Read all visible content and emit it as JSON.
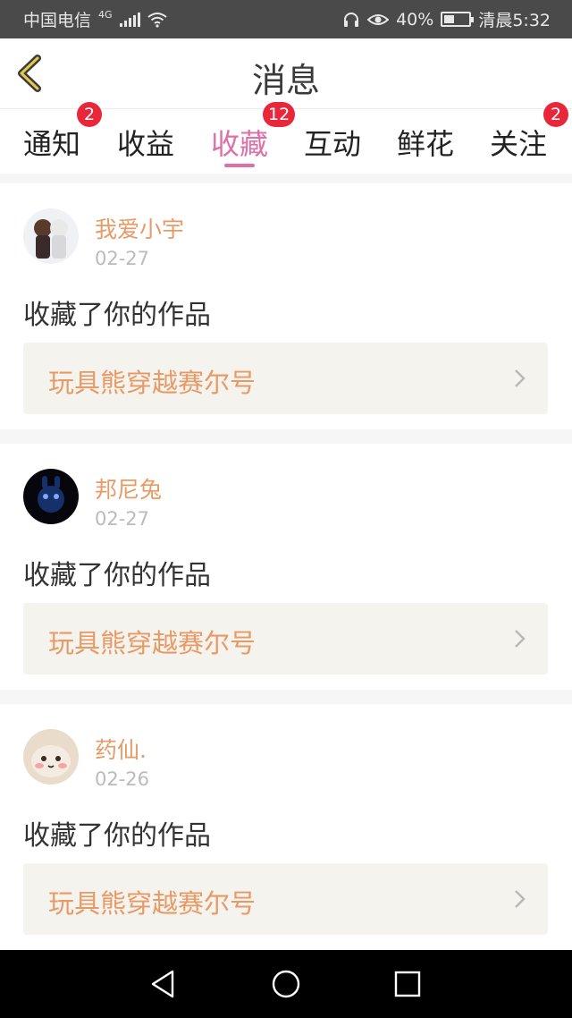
{
  "status": {
    "carrier": "中国电信",
    "network": "4G",
    "battery": "40%",
    "time": "清晨5:32"
  },
  "header": {
    "title": "消息"
  },
  "tabs": [
    {
      "label": "通知",
      "badge": "2"
    },
    {
      "label": "收益",
      "badge": ""
    },
    {
      "label": "收藏",
      "badge": "12"
    },
    {
      "label": "互动",
      "badge": ""
    },
    {
      "label": "鲜花",
      "badge": ""
    },
    {
      "label": "关注",
      "badge": "2"
    }
  ],
  "messages": [
    {
      "username": "我爱小宇",
      "date": "02-27",
      "action": "收藏了你的作品",
      "work": "玩具熊穿越赛尔号"
    },
    {
      "username": "邦尼兔",
      "date": "02-27",
      "action": "收藏了你的作品",
      "work": "玩具熊穿越赛尔号"
    },
    {
      "username": "药仙.",
      "date": "02-26",
      "action": "收藏了你的作品",
      "work": "玩具熊穿越赛尔号"
    }
  ],
  "colors": {
    "accent": "#e06fa7",
    "name": "#e79a66",
    "badge": "#e8283a"
  },
  "icons": [
    "back-arrow-icon",
    "chevron-right-icon",
    "nav-back-icon",
    "nav-home-icon",
    "nav-recents-icon"
  ]
}
